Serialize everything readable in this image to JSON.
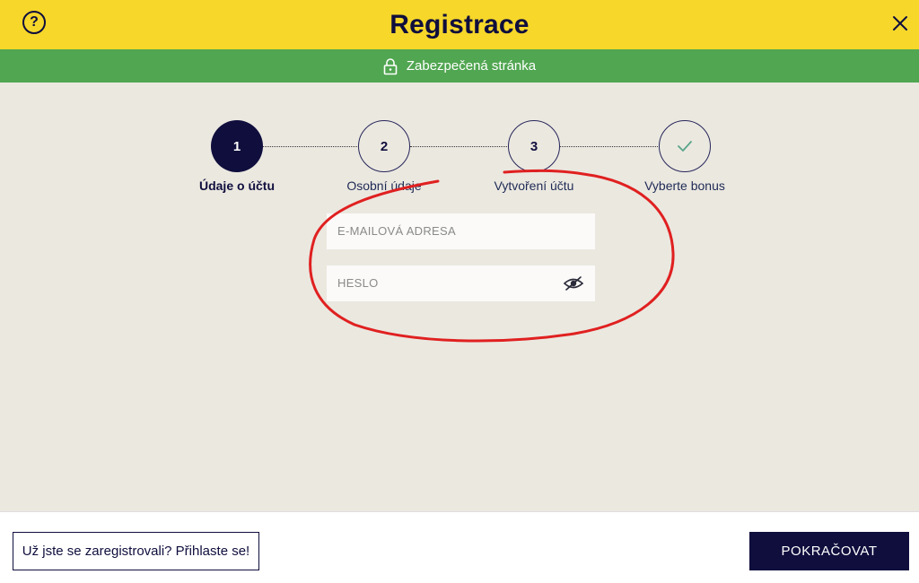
{
  "header": {
    "title": "Registrace",
    "help_icon": "question-circle-icon",
    "close_icon": "close-icon",
    "bg_color": "#f6d72a"
  },
  "secure_bar": {
    "text": "Zabezpečená stránka",
    "icon": "lock-icon",
    "bg_color": "#51a651"
  },
  "steps": [
    {
      "number": "1",
      "label": "Údaje o účtu",
      "state": "active"
    },
    {
      "number": "2",
      "label": "Osobní údaje",
      "state": "inactive"
    },
    {
      "number": "3",
      "label": "Vytvoření účtu",
      "state": "inactive"
    },
    {
      "number": "",
      "label": "Vyberte bonus",
      "state": "inactive",
      "icon": "check-icon"
    }
  ],
  "form": {
    "email": {
      "placeholder": "E-MAILOVÁ ADRESA",
      "value": ""
    },
    "password": {
      "placeholder": "HESLO",
      "value": "",
      "toggle_icon": "eye-hidden-icon"
    }
  },
  "annotation": {
    "color": "#e02020"
  },
  "footer": {
    "login_link": "Už jste se zaregistrovali? Přihlaste se!",
    "continue_button": "POKRAČOVAT"
  },
  "colors": {
    "brand_navy": "#0f0e3d",
    "content_bg": "#ebe8e0"
  }
}
